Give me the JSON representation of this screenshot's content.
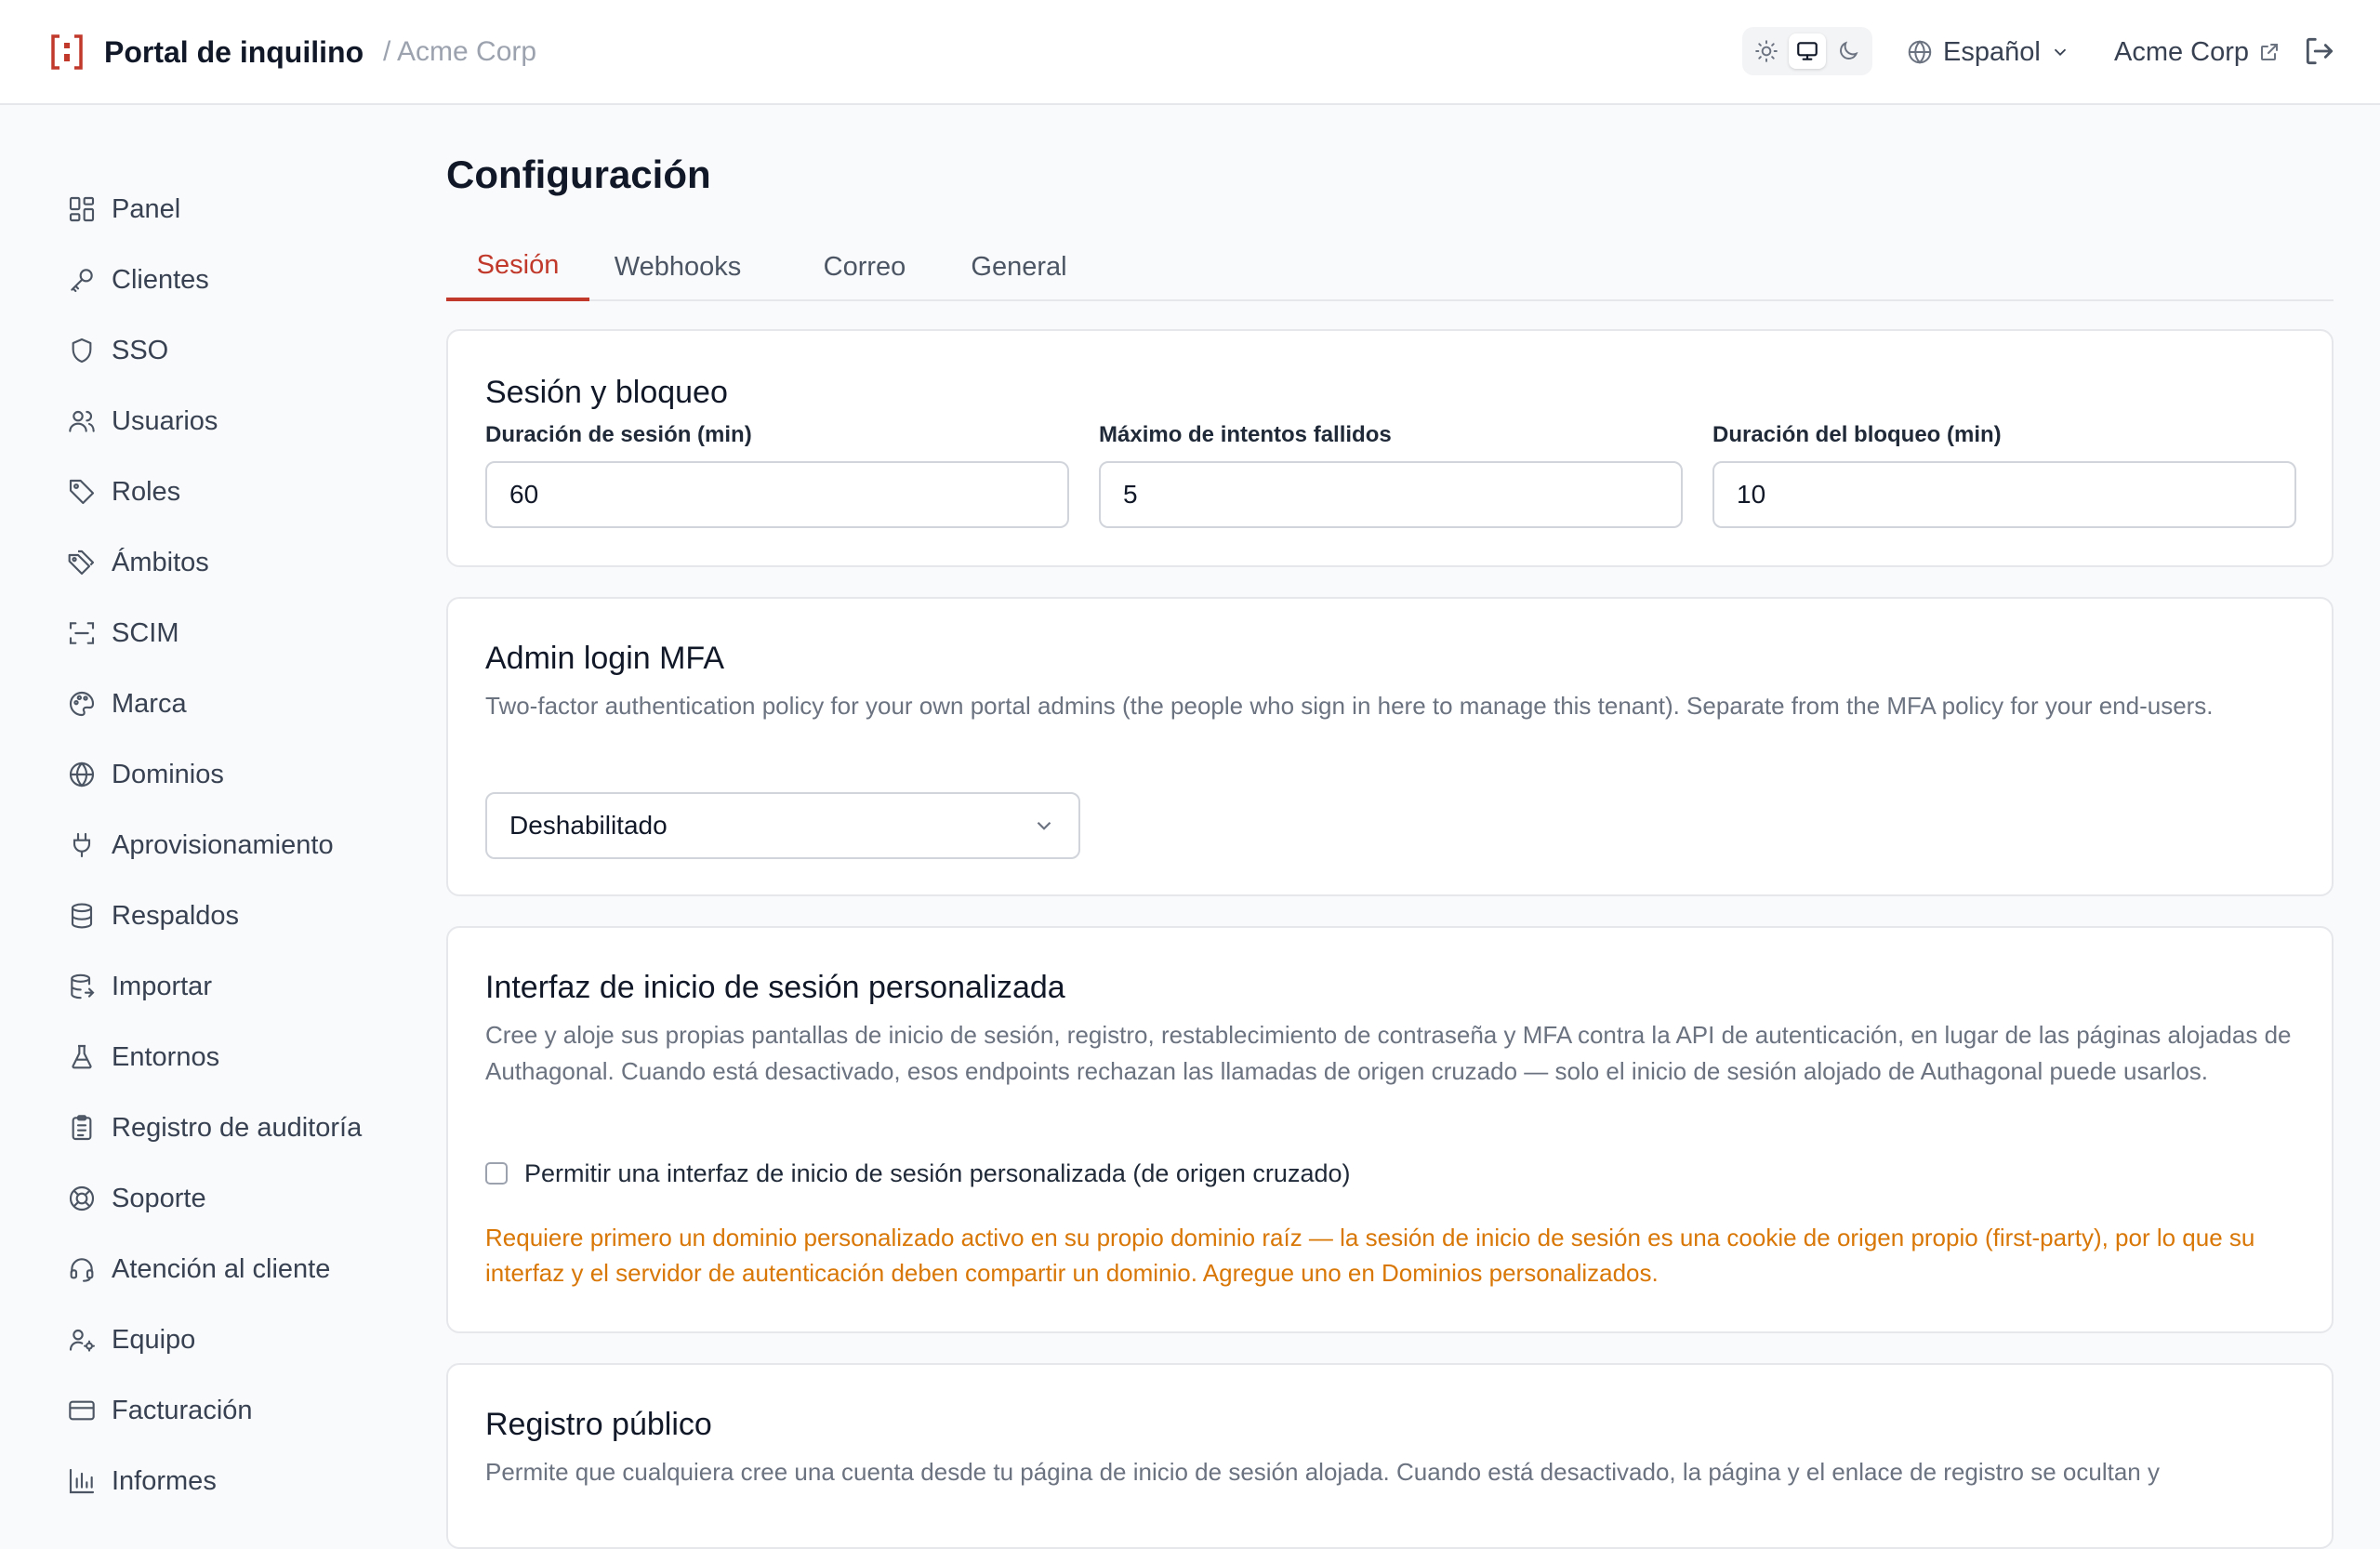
{
  "header": {
    "title": "Portal de inquilino",
    "tenant": "/ Acme Corp",
    "language": "Español",
    "account": "Acme Corp",
    "accent_color": "#c0392b"
  },
  "sidebar": {
    "items": [
      {
        "label": "Panel",
        "icon": "dashboard-icon"
      },
      {
        "label": "Clientes",
        "icon": "key-icon"
      },
      {
        "label": "SSO",
        "icon": "shield-icon"
      },
      {
        "label": "Usuarios",
        "icon": "users-icon"
      },
      {
        "label": "Roles",
        "icon": "tag-icon"
      },
      {
        "label": "Ámbitos",
        "icon": "tags-icon"
      },
      {
        "label": "SCIM",
        "icon": "scan-icon"
      },
      {
        "label": "Marca",
        "icon": "palette-icon"
      },
      {
        "label": "Dominios",
        "icon": "globe-icon"
      },
      {
        "label": "Aprovisionamiento",
        "icon": "plug-icon"
      },
      {
        "label": "Respaldos",
        "icon": "database-icon"
      },
      {
        "label": "Importar",
        "icon": "database-import-icon"
      },
      {
        "label": "Entornos",
        "icon": "flask-icon"
      },
      {
        "label": "Registro de auditoría",
        "icon": "clipboard-icon"
      },
      {
        "label": "Soporte",
        "icon": "lifebuoy-icon"
      },
      {
        "label": "Atención al cliente",
        "icon": "headset-icon"
      },
      {
        "label": "Equipo",
        "icon": "user-cog-icon"
      },
      {
        "label": "Facturación",
        "icon": "credit-card-icon"
      },
      {
        "label": "Informes",
        "icon": "bar-chart-icon"
      }
    ]
  },
  "main": {
    "title": "Configuración",
    "tabs": [
      {
        "label": "Sesión",
        "active": true
      },
      {
        "label": "Webhooks",
        "active": false
      },
      {
        "label": "Correo",
        "active": false
      },
      {
        "label": "General",
        "active": false
      }
    ],
    "session": {
      "title": "Sesión y bloqueo",
      "fields": [
        {
          "label": "Duración de sesión (min)",
          "value": "60"
        },
        {
          "label": "Máximo de intentos fallidos",
          "value": "5"
        },
        {
          "label": "Duración del bloqueo (min)",
          "value": "10"
        }
      ]
    },
    "mfa": {
      "title": "Admin login MFA",
      "description": "Two-factor authentication policy for your own portal admins (the people who sign in here to manage this tenant). Separate from the MFA policy for your end-users.",
      "selected": "Deshabilitado"
    },
    "custom_ui": {
      "title": "Interfaz de inicio de sesión personalizada",
      "description": "Cree y aloje sus propias pantallas de inicio de sesión, registro, restablecimiento de contraseña y MFA contra la API de autenticación, en lugar de las páginas alojadas de Authagonal. Cuando está desactivado, esos endpoints rechazan las llamadas de origen cruzado — solo el inicio de sesión alojado de Authagonal puede usarlos.",
      "checkbox_label": "Permitir una interfaz de inicio de sesión personalizada (de origen cruzado)",
      "checked": false,
      "warning": "Requiere primero un dominio personalizado activo en su propio dominio raíz — la sesión de inicio de sesión es una cookie de origen propio (first-party), por lo que su interfaz y el servidor de autenticación deben compartir un dominio. Agregue uno en Dominios personalizados.",
      "warning_color": "#d97706"
    },
    "registration": {
      "title": "Registro público",
      "description": "Permite que cualquiera cree una cuenta desde tu página de inicio de sesión alojada. Cuando está desactivado, la página y el enlace de registro se ocultan y"
    }
  }
}
